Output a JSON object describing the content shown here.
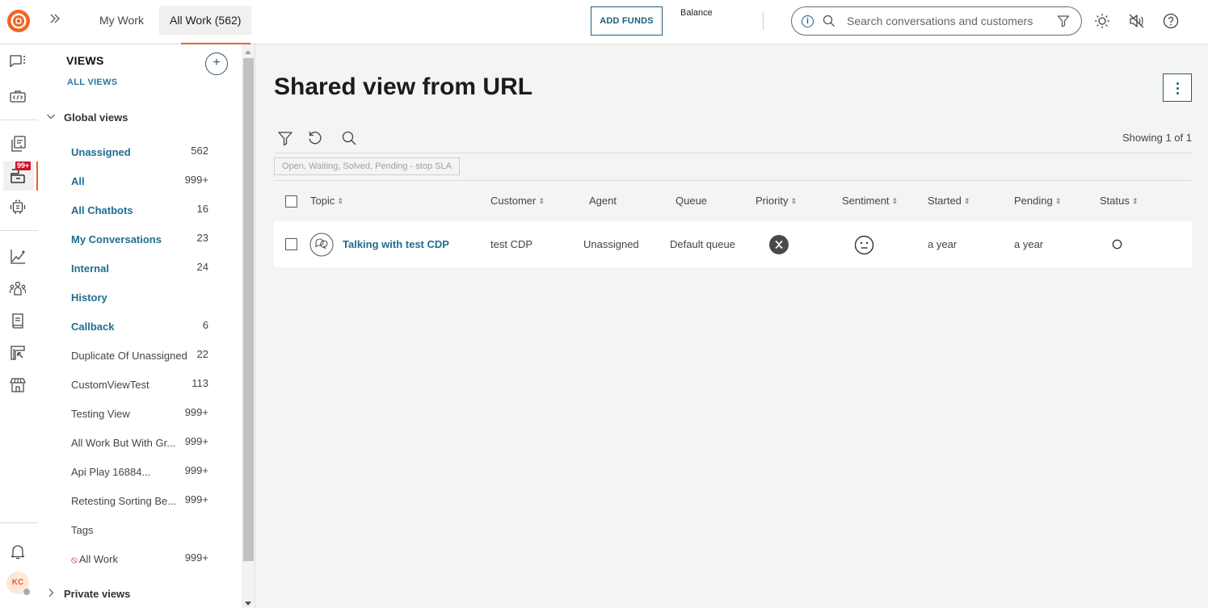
{
  "topbar": {
    "logo": "brand-logo",
    "tabs": [
      {
        "label": "My Work",
        "active": false
      },
      {
        "label": "All Work (562)",
        "active": true
      }
    ],
    "add_funds_label": "ADD FUNDS",
    "balance_label": "Balance",
    "search": {
      "placeholder": "Search conversations and customers",
      "value": ""
    },
    "icons": [
      "info-icon",
      "search-icon",
      "filter-icon",
      "theme-sun-icon",
      "sound-muted-icon",
      "help-icon"
    ]
  },
  "rail": {
    "items": [
      {
        "icon": "conversations-icon"
      },
      {
        "icon": "developer-toolbox-icon"
      },
      {
        "icon": "copy-inbox-icon"
      },
      {
        "icon": "work-queue-icon",
        "badge": "99+",
        "active": true
      },
      {
        "icon": "chatbot-icon"
      },
      {
        "icon": "analytics-icon"
      },
      {
        "icon": "team-icon"
      },
      {
        "icon": "knowledge-book-icon"
      },
      {
        "icon": "campaign-icon"
      },
      {
        "icon": "marketplace-icon"
      }
    ],
    "notifications_icon": "bell-icon",
    "avatar_initials": "KC",
    "accent_color": "#e8612c"
  },
  "views": {
    "title": "VIEWS",
    "all_views_link": "ALL VIEWS",
    "global_group": {
      "label": "Global views",
      "expanded": true,
      "items": [
        {
          "label": "Unassigned",
          "count": "562",
          "bold": true
        },
        {
          "label": "All",
          "count": "999+",
          "bold": true
        },
        {
          "label": "All Chatbots",
          "count": "16",
          "bold": true
        },
        {
          "label": "My Conversations",
          "count": "23",
          "bold": true
        },
        {
          "label": "Internal",
          "count": "24",
          "bold": true
        },
        {
          "label": "History",
          "count": "",
          "bold": true
        },
        {
          "label": "Callback",
          "count": "6",
          "bold": true
        },
        {
          "label": "Duplicate Of Unassigned",
          "count": "22",
          "bold": false
        },
        {
          "label": "CustomViewTest",
          "count": "113",
          "bold": false
        },
        {
          "label": "Testing View",
          "count": "999+",
          "bold": false
        },
        {
          "label": "All Work But With Gr...",
          "count": "999+",
          "bold": false
        },
        {
          "label": "Api Play 16884...",
          "count": "999+",
          "bold": false
        },
        {
          "label": "Retesting Sorting Be...",
          "count": "999+",
          "bold": false
        },
        {
          "label": "Tags",
          "count": "",
          "bold": false
        },
        {
          "label": "All Work",
          "count": "999+",
          "bold": false,
          "disabled_icon": true
        }
      ]
    },
    "private_group": {
      "label": "Private views",
      "expanded": false
    }
  },
  "main": {
    "title": "Shared view from URL",
    "showing": "Showing 1 of 1",
    "filter_chip": "Open, Waiting, Solved, Pending - stop SLA",
    "columns": [
      {
        "label": "Topic",
        "sortable": true
      },
      {
        "label": "Customer",
        "sortable": true
      },
      {
        "label": "Agent",
        "sortable": false
      },
      {
        "label": "Queue",
        "sortable": false
      },
      {
        "label": "Priority",
        "sortable": true
      },
      {
        "label": "Sentiment",
        "sortable": true
      },
      {
        "label": "Started",
        "sortable": true
      },
      {
        "label": "Pending",
        "sortable": true
      },
      {
        "label": "Status",
        "sortable": true
      }
    ],
    "rows": [
      {
        "channel_icon": "chat-bubbles-icon",
        "topic": "Talking with test CDP",
        "customer": "test CDP",
        "agent": "Unassigned",
        "queue": "Default queue",
        "priority_icon": "priority-none-icon",
        "sentiment_icon": "neutral-face-icon",
        "started": "a year",
        "pending": "a year",
        "status_icon": "status-open-circle-icon"
      }
    ]
  }
}
